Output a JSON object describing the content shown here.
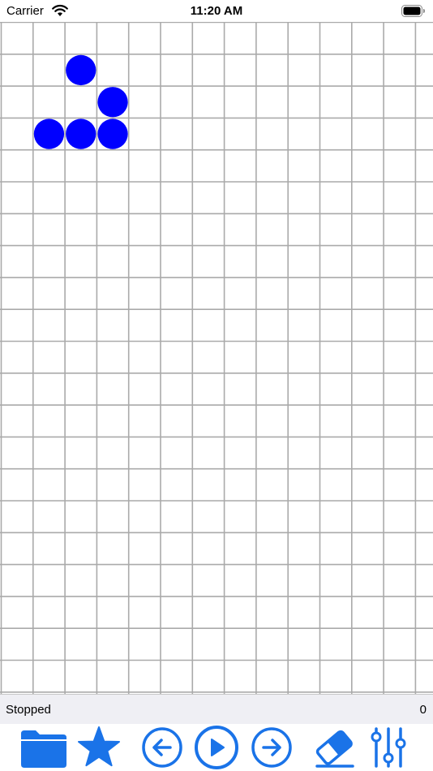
{
  "status_bar": {
    "carrier": "Carrier",
    "time": "11:20 AM",
    "wifi_icon": "wifi-icon",
    "battery_icon": "battery-icon"
  },
  "grid": {
    "columns": 14,
    "rows": 21,
    "line_color": "#aaaaaa",
    "cell_color": "#0000ff",
    "live_cells": [
      {
        "col": 2,
        "row": 1
      },
      {
        "col": 3,
        "row": 2
      },
      {
        "col": 1,
        "row": 3
      },
      {
        "col": 2,
        "row": 3
      },
      {
        "col": 3,
        "row": 3
      }
    ]
  },
  "info_bar": {
    "state": "Stopped",
    "generation": "0"
  },
  "toolbar": {
    "accent_color": "#1a73e8",
    "items": [
      {
        "name": "folder-icon",
        "action": "open"
      },
      {
        "name": "star-icon",
        "action": "favorites"
      },
      {
        "name": "back-arrow-icon",
        "action": "previous-generation"
      },
      {
        "name": "play-icon",
        "action": "play"
      },
      {
        "name": "forward-arrow-icon",
        "action": "next-generation"
      },
      {
        "name": "eraser-icon",
        "action": "clear"
      },
      {
        "name": "sliders-icon",
        "action": "settings"
      }
    ]
  }
}
